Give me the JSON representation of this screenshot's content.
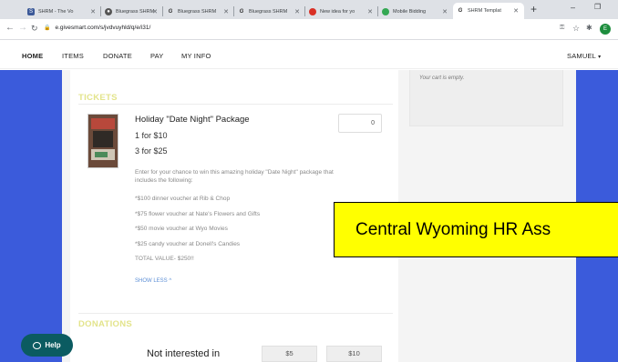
{
  "browser": {
    "tabs": [
      {
        "label": "SHRM - The Vo",
        "icon": "shrm-favicon",
        "active": false
      },
      {
        "label": "Bluegrass SHRM",
        "icon": "globe-favicon",
        "active": false
      },
      {
        "label": "Bluegrass SHRM",
        "icon": "g-favicon",
        "active": false
      },
      {
        "label": "Bluegrass SHRM",
        "icon": "g-favicon",
        "active": false
      },
      {
        "label": "New idea for yo",
        "icon": "red-favicon",
        "active": false
      },
      {
        "label": "Mobile Bidding",
        "icon": "leaf-favicon",
        "active": false
      },
      {
        "label": "SHRM Templat",
        "icon": "g-favicon",
        "active": true
      }
    ],
    "url": "e.givesmart.com/s/jvdvuyhld/q/e/i31/",
    "profile_initial": "E"
  },
  "site_nav": {
    "items": [
      "HOME",
      "ITEMS",
      "DONATE",
      "PAY",
      "MY INFO"
    ],
    "user": "SAMUEL"
  },
  "cart": {
    "empty_text": "Your cart is empty."
  },
  "tickets": {
    "section_title": "TICKETS",
    "item": {
      "title": "Holiday \"Date Night\" Package",
      "price_1": "1 for $10",
      "price_2": "3 for $25",
      "quantity": "0",
      "description": [
        "Enter for your chance to win this amazing holiday \"Date Night\" package that includes the following:",
        "*$100 dinner voucher at Rib & Chop",
        "*$75 flower voucher at Nate's Flowers and Gifts",
        "*$50 movie voucher at Wyo Movies",
        "*$25 candy voucher at Donell's Candies",
        "TOTAL VALUE- $250!!"
      ],
      "show_less": "SHOW LESS"
    }
  },
  "donations": {
    "section_title": "DONATIONS",
    "not_interested": "Not interested in",
    "amounts": [
      "$5",
      "$10"
    ]
  },
  "help_label": "Help",
  "banner_text": "Central Wyoming HR Ass",
  "colors": {
    "accent_blue": "#3b5bdb",
    "section_yellow": "#e3e48b",
    "banner_yellow": "#ffff00",
    "help_teal": "#0b5b61"
  }
}
